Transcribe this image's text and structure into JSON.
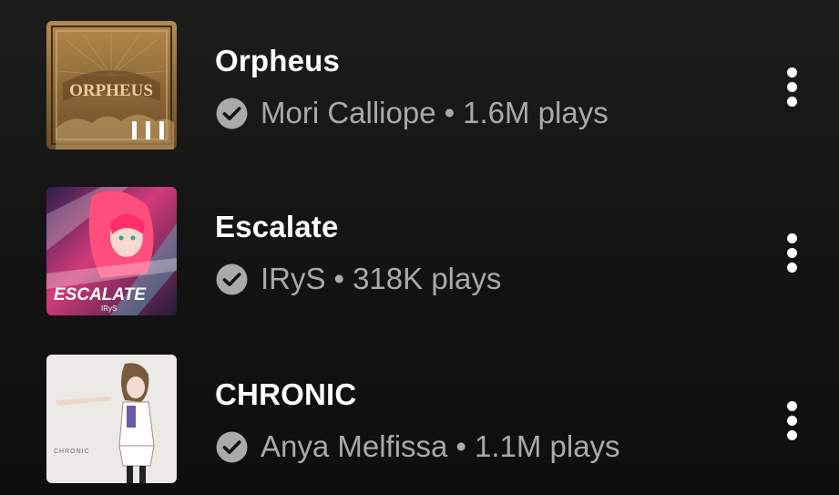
{
  "tracks": [
    {
      "title": "Orpheus",
      "artist": "Mori Calliope",
      "separator": "•",
      "plays": "1.6M plays",
      "artwork_text": "ORPHEUS",
      "now_playing": true
    },
    {
      "title": "Escalate",
      "artist": "IRyS",
      "separator": "•",
      "plays": "318K plays",
      "artwork_text": "ESCALATE",
      "artwork_subtext": "IRyS",
      "now_playing": false
    },
    {
      "title": "CHRONIC",
      "artist": "Anya Melfissa",
      "separator": "•",
      "plays": "1.1M plays",
      "artwork_text": "CHRONIC",
      "now_playing": false
    }
  ],
  "icons": {
    "verified": "check-circle-icon",
    "more": "more-vert-icon",
    "now_playing": "equalizer-icon"
  },
  "colors": {
    "background": "#141414",
    "title": "#ffffff",
    "subtitle": "#aaaaaa"
  }
}
